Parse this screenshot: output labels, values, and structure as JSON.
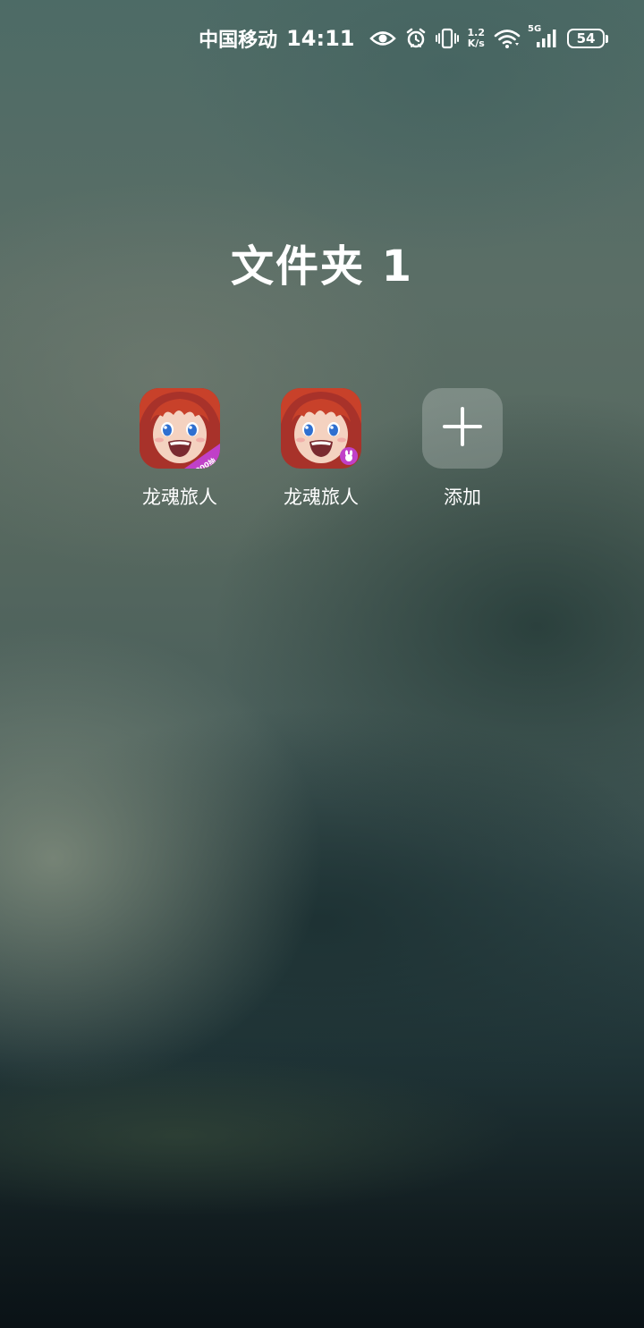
{
  "status_bar": {
    "carrier": "中国移动",
    "time": "14:11",
    "net_speed_value": "1.2",
    "net_speed_unit": "K/s",
    "network_type": "5G",
    "battery_level": "54",
    "icons": [
      "eye-icon",
      "alarm-icon",
      "vibrate-icon",
      "wifi-icon",
      "signal-5g-icon",
      "battery-icon"
    ]
  },
  "folder": {
    "title": "文件夹 1",
    "apps": [
      {
        "label": "龙魂旅人",
        "icon": "anime-girl-app-icon",
        "badge_text": "1000抽"
      },
      {
        "label": "龙魂旅人",
        "icon": "anime-girl-app-icon",
        "badge_icon": "bunny-badge-icon"
      }
    ],
    "add_button": {
      "label": "添加",
      "icon": "plus-icon"
    }
  },
  "colors": {
    "badge_purple": "#c040c8",
    "hair_red": "#c8412a",
    "eye_blue": "#2e6fd0"
  }
}
